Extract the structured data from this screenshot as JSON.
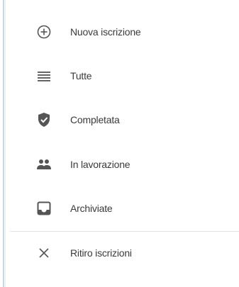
{
  "menu": {
    "items": [
      {
        "label": "Nuova iscrizione",
        "icon": "add-circle-icon"
      },
      {
        "label": "Tutte",
        "icon": "list-lines-icon"
      },
      {
        "label": "Completata",
        "icon": "shield-check-icon"
      },
      {
        "label": "In lavorazione",
        "icon": "people-icon"
      },
      {
        "label": "Archiviate",
        "icon": "inbox-tray-icon"
      },
      {
        "label": "Ritiro iscrizioni",
        "icon": "close-icon"
      }
    ]
  },
  "colors": {
    "icon": "#555555",
    "text": "#3a3a3a",
    "divider": "#e3e3e3",
    "edge": "#c9d6e6"
  }
}
